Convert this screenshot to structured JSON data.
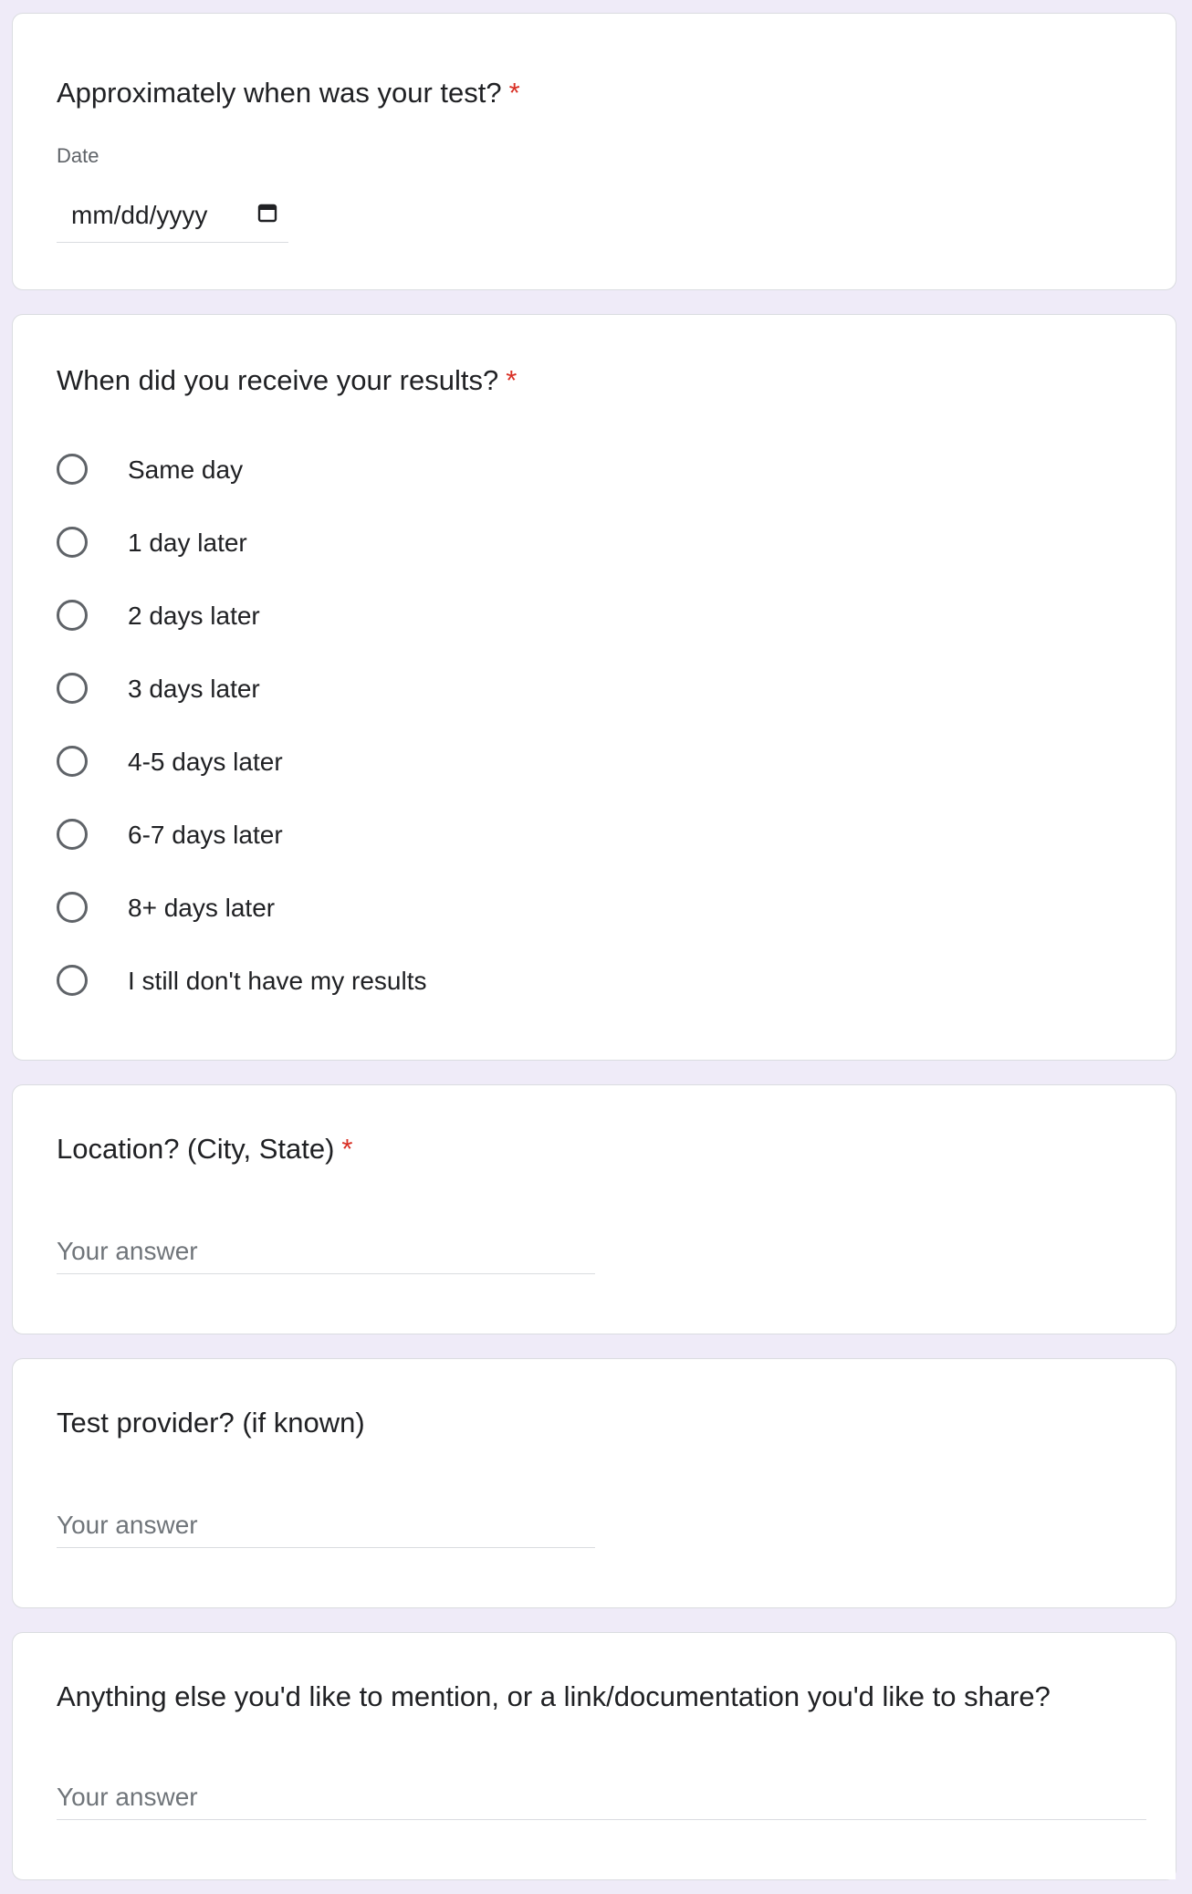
{
  "questions": {
    "test_date": {
      "title": "Approximately when was your test?",
      "required_mark": "*",
      "field_label": "Date",
      "date_placeholder": "mm/dd/yyyy",
      "icon": "calendar-icon"
    },
    "results_timing": {
      "title": "When did you receive your results?",
      "required_mark": "*",
      "options": [
        "Same day",
        "1 day later",
        "2 days later",
        "3 days later",
        "4-5 days later",
        "6-7 days later",
        "8+ days later",
        "I still don't have my results"
      ]
    },
    "location": {
      "title": "Location? (City, State)",
      "required_mark": "*",
      "placeholder": "Your answer"
    },
    "provider": {
      "title": "Test provider? (if known)",
      "placeholder": "Your answer"
    },
    "anything_else": {
      "title": "Anything else you'd like to mention, or a link/documentation you'd like to share?",
      "placeholder": "Your answer"
    }
  },
  "colors": {
    "background": "#efebf8",
    "required": "#d93025",
    "border": "#dadce0"
  }
}
